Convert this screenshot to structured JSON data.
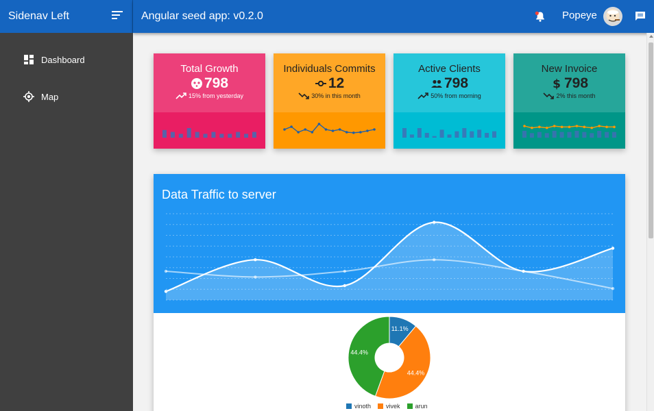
{
  "sidenav": {
    "title": "Sidenav Left"
  },
  "topbar": {
    "app_title": "Angular seed app: v0.2.0",
    "user_name": "Popeye"
  },
  "sidebar": {
    "items": [
      {
        "label": "Dashboard",
        "icon": "dashboard-icon"
      },
      {
        "label": "Map",
        "icon": "location-icon"
      }
    ]
  },
  "cards": [
    {
      "title": "Total Growth",
      "value": "798",
      "icon": "face-icon",
      "sub": "15% from yesterday",
      "trend": "up",
      "color_top": "#ec407a",
      "color_bottom": "#e91e63",
      "mini_type": "bar",
      "mini_values": [
        4,
        3,
        2,
        5,
        3,
        2,
        3,
        2,
        2,
        3,
        2,
        3
      ]
    },
    {
      "title": "Individuals Commits",
      "value": "12",
      "icon": "commit-icon",
      "sub": "30% in this month",
      "trend": "down",
      "color_top": "#ffa726",
      "color_bottom": "#ff9800",
      "mini_type": "line",
      "mini_values": [
        3,
        4,
        2,
        3,
        2,
        5,
        3,
        2.5,
        3,
        2,
        1.8,
        2,
        2.5,
        3
      ]
    },
    {
      "title": "Active Clients",
      "value": "798",
      "icon": "people-icon",
      "sub": "50% from morning",
      "trend": "up",
      "color_top": "#26c6da",
      "color_bottom": "#00bcd4",
      "mini_type": "bar",
      "mini_values": [
        3,
        1,
        3,
        1.5,
        0.5,
        2.5,
        1,
        2,
        3,
        2,
        2.5,
        1.5,
        2
      ]
    },
    {
      "title": "New Invoice",
      "value": "798",
      "icon": "dollar-icon",
      "sub": "2% this month",
      "trend": "down",
      "color_top": "#26a69a",
      "color_bottom": "#009688",
      "mini_type": "combo",
      "mini_values": [
        3,
        2,
        2.5,
        2,
        3,
        2.5,
        2.5,
        3,
        2.5,
        2,
        3,
        2.5,
        2.5
      ]
    }
  ],
  "traffic": {
    "title": "Data Traffic to server"
  },
  "chart_data": [
    {
      "type": "line",
      "x": [
        0,
        1,
        2,
        3,
        4,
        5
      ],
      "series": [
        {
          "values": [
            0.3,
            1.4,
            0.5,
            2.7,
            1.0,
            1.8
          ]
        },
        {
          "values": [
            1.0,
            0.8,
            1.0,
            1.4,
            1.0,
            0.4
          ]
        }
      ],
      "ylim": [
        0,
        3
      ],
      "grid": true
    },
    {
      "type": "pie",
      "labels": [
        "vinoth",
        "vivek",
        "arun"
      ],
      "values": [
        11.1,
        44.4,
        44.4
      ],
      "value_labels": [
        "11.1%",
        "44.4%",
        "44.4%"
      ],
      "colors": [
        "#1f77b4",
        "#ff7f0e",
        "#2ca02c"
      ],
      "legend": "bottom"
    }
  ]
}
